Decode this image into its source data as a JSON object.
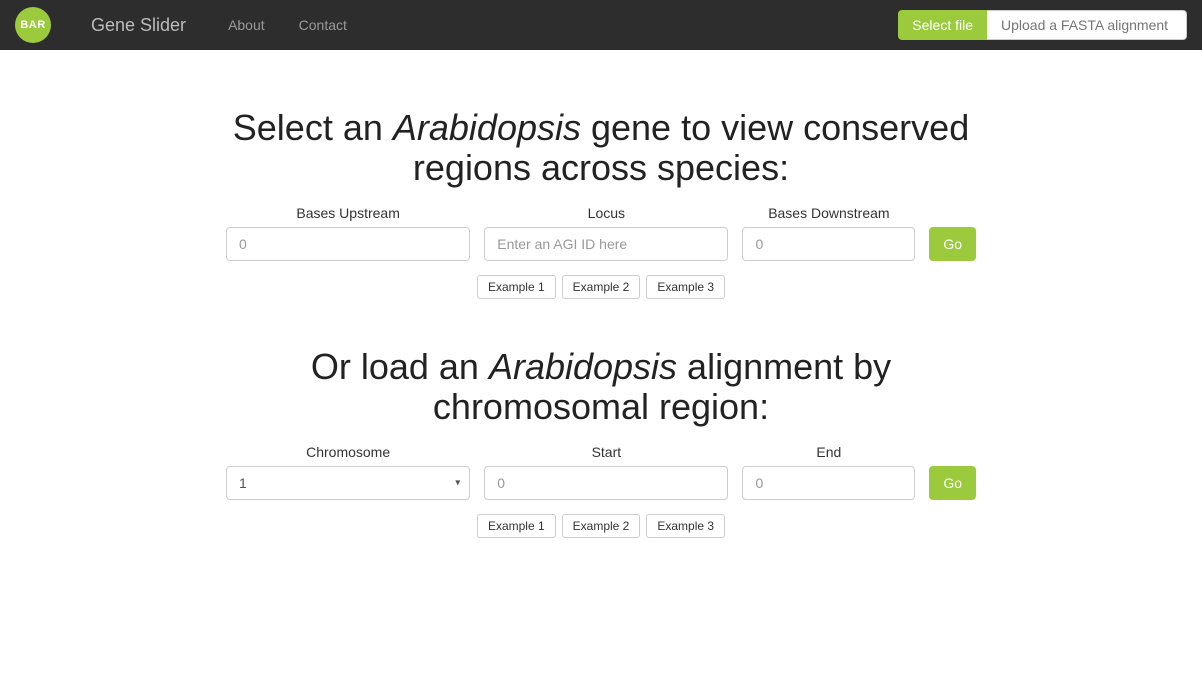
{
  "navbar": {
    "logo_text": "BAR",
    "brand": "Gene Slider",
    "about": "About",
    "contact": "Contact",
    "select_file": "Select file",
    "upload_placeholder": "Upload a FASTA alignment"
  },
  "section1": {
    "heading_pre": "Select an ",
    "heading_em": "Arabidopsis",
    "heading_post": " gene to view conserved regions across species:",
    "upstream_label": "Bases Upstream",
    "upstream_placeholder": "0",
    "locus_label": "Locus",
    "locus_placeholder": "Enter an AGI ID here",
    "downstream_label": "Bases Downstream",
    "downstream_placeholder": "0",
    "go": "Go",
    "examples": [
      "Example 1",
      "Example 2",
      "Example 3"
    ]
  },
  "section2": {
    "heading_pre": "Or load an ",
    "heading_em": "Arabidopsis",
    "heading_post": " alignment by chromosomal region:",
    "chromosome_label": "Chromosome",
    "chromosome_value": "1",
    "start_label": "Start",
    "start_placeholder": "0",
    "end_label": "End",
    "end_placeholder": "0",
    "go": "Go",
    "examples": [
      "Example 1",
      "Example 2",
      "Example 3"
    ]
  }
}
